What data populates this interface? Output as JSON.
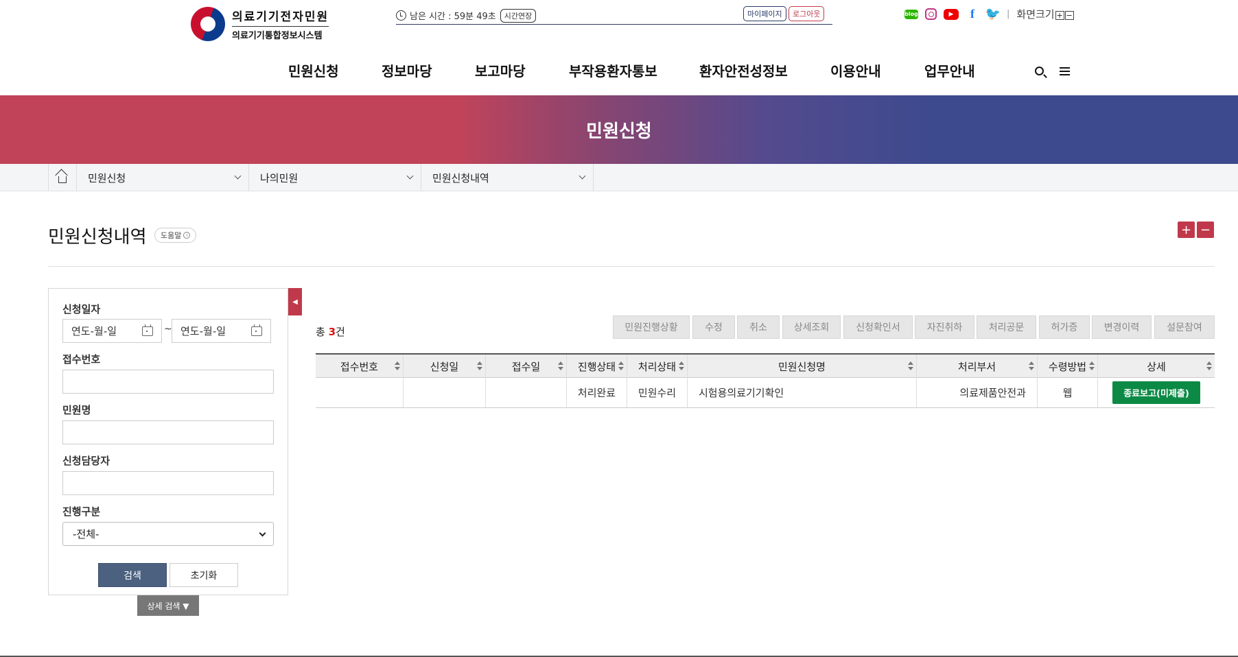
{
  "header": {
    "logo_title": "의료기기전자민원",
    "logo_subtitle": "의료기기통합정보시스템",
    "timer_text": "남은 시간 : 59분 49초",
    "extend_label": "시간연장",
    "mypage_label": "마이페이지",
    "logout_label": "로그아웃",
    "sns": {
      "blog": "blog",
      "youtube": "▶",
      "facebook": "f",
      "twitter": "🐦"
    },
    "separator": "|",
    "zoom_label": "화면크기",
    "zoom_in": "+",
    "zoom_out": "−"
  },
  "gnb": [
    "민원신청",
    "정보마당",
    "보고마당",
    "부작용환자통보",
    "환자안전성정보",
    "이용안내",
    "업무안내"
  ],
  "banner": {
    "title": "민원신청"
  },
  "breadcrumb": [
    "민원신청",
    "나의민원",
    "민원신청내역"
  ],
  "page": {
    "title": "민원신청내역",
    "help_label": "도움말",
    "help_icon": "i",
    "font_plus": "+",
    "font_minus": "−"
  },
  "search": {
    "collapse_icon": "◀",
    "date_label": "신청일자",
    "date_from_placeholder": "연도-월-일",
    "date_to_placeholder": "연도-월-일",
    "tilde": "~",
    "receipt_label": "접수번호",
    "complaint_label": "민원명",
    "applicant_label": "신청담당자",
    "progress_label": "진행구분",
    "progress_value": "-전체-",
    "search_button": "검색",
    "reset_button": "초기화",
    "detail_button": "상세 검색 ▼"
  },
  "results": {
    "total_prefix": "총 ",
    "total_count": "3",
    "total_suffix": "건",
    "actions": [
      "민원진행상황",
      "수정",
      "취소",
      "상세조회",
      "신청확인서",
      "자진취하",
      "처리공문",
      "허가증",
      "변경이력",
      "설문참여"
    ],
    "columns": [
      "접수번호",
      "신청일",
      "접수일",
      "진행상태",
      "처리상태",
      "민원신청명",
      "처리부서",
      "수령방법",
      "상세"
    ],
    "rows": [
      {
        "receipt_no": "",
        "apply_date": "",
        "receipt_date": "",
        "progress": "처리완료",
        "process": "민원수리",
        "name": "시험용의료기기확인",
        "dept": "의료제품안전과",
        "method": "웹",
        "detail": "종료보고(미제출)"
      }
    ]
  },
  "colors": {
    "accent": "#c0394b",
    "navy": "#3e4a8e",
    "search_button": "#4b617f",
    "detail_button": "#0c8a45"
  }
}
